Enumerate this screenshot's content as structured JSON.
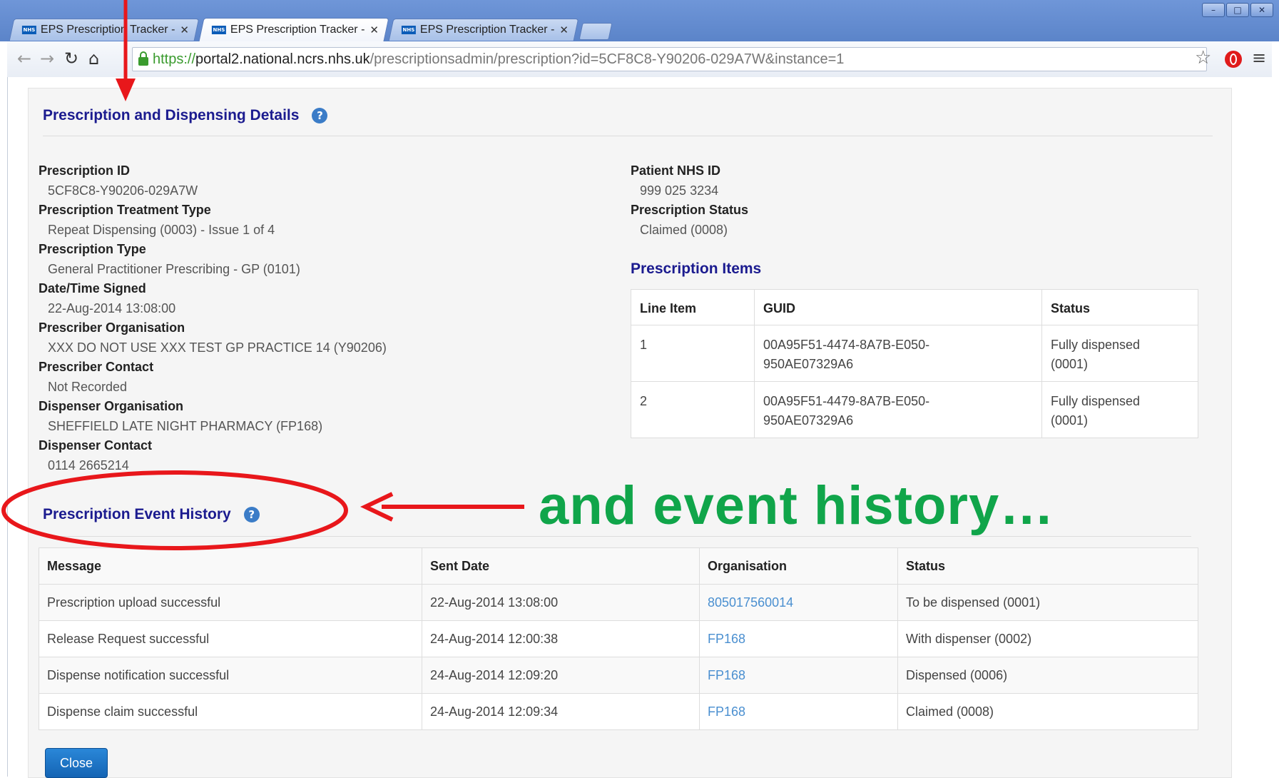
{
  "browser": {
    "tabs": [
      {
        "title": "EPS Prescription Tracker -",
        "favicon": "NHS"
      },
      {
        "title": "EPS Prescription Tracker -",
        "favicon": "NHS"
      },
      {
        "title": "EPS Prescription Tracker -",
        "favicon": "NHS"
      }
    ],
    "url": {
      "scheme": "https://",
      "host": "portal2.national.ncrs.nhs.uk",
      "path": "/prescriptionsadmin/prescription?id=5CF8C8-Y90206-029A7W&instance=1"
    },
    "icons": {
      "back": "back-arrow-icon",
      "forward": "forward-arrow-icon",
      "reload": "reload-icon",
      "home": "home-icon",
      "lock": "lock-icon",
      "bookmark": "star-icon",
      "extension": "opera-icon",
      "menu": "menu-icon"
    }
  },
  "details": {
    "title": "Prescription and Dispensing Details",
    "left": [
      {
        "label": "Prescription ID",
        "value": "5CF8C8-Y90206-029A7W"
      },
      {
        "label": "Prescription Treatment Type",
        "value": "Repeat Dispensing (0003) - Issue 1 of 4"
      },
      {
        "label": "Prescription Type",
        "value": "General Practitioner Prescribing - GP (0101)"
      },
      {
        "label": "Date/Time Signed",
        "value": "22-Aug-2014 13:08:00"
      },
      {
        "label": "Prescriber Organisation",
        "value": "XXX DO NOT USE XXX TEST GP PRACTICE 14 (Y90206)"
      },
      {
        "label": "Prescriber Contact",
        "value": "Not Recorded"
      },
      {
        "label": "Dispenser Organisation",
        "value": "SHEFFIELD LATE NIGHT PHARMACY (FP168)"
      },
      {
        "label": "Dispenser Contact",
        "value": "0114 2665214"
      }
    ],
    "right": [
      {
        "label": "Patient NHS ID",
        "value": "999 025 3234"
      },
      {
        "label": "Prescription Status",
        "value": "Claimed (0008)"
      }
    ]
  },
  "items": {
    "title": "Prescription Items",
    "columns": [
      "Line Item",
      "GUID",
      "Status"
    ],
    "rows": [
      {
        "line": "1",
        "guid_1": "00A95F51-4474-8A7B-E050-",
        "guid_2": "950AE07329A6",
        "status_1": "Fully dispensed",
        "status_2": "(0001)"
      },
      {
        "line": "2",
        "guid_1": "00A95F51-4479-8A7B-E050-",
        "guid_2": "950AE07329A6",
        "status_1": "Fully dispensed",
        "status_2": "(0001)"
      }
    ]
  },
  "history": {
    "title": "Prescription Event History",
    "columns": [
      "Message",
      "Sent Date",
      "Organisation",
      "Status"
    ],
    "rows": [
      {
        "message": "Prescription upload successful",
        "date": "22-Aug-2014 13:08:00",
        "org": "805017560014",
        "status": "To be dispensed (0001)"
      },
      {
        "message": "Release Request successful",
        "date": "24-Aug-2014 12:00:38",
        "org": "FP168",
        "status": "With dispenser (0002)"
      },
      {
        "message": "Dispense notification successful",
        "date": "24-Aug-2014 12:09:20",
        "org": "FP168",
        "status": "Dispensed (0006)"
      },
      {
        "message": "Dispense claim successful",
        "date": "24-Aug-2014 12:09:34",
        "org": "FP168",
        "status": "Claimed (0008)"
      }
    ]
  },
  "close_label": "Close",
  "annotation": {
    "text": "and event history…",
    "text_color": "#10a54a",
    "arrow_color": "#e8171b"
  },
  "colors": {
    "heading": "#1b1b8f",
    "link": "#4a8fd0",
    "button": "#1a74c6"
  }
}
